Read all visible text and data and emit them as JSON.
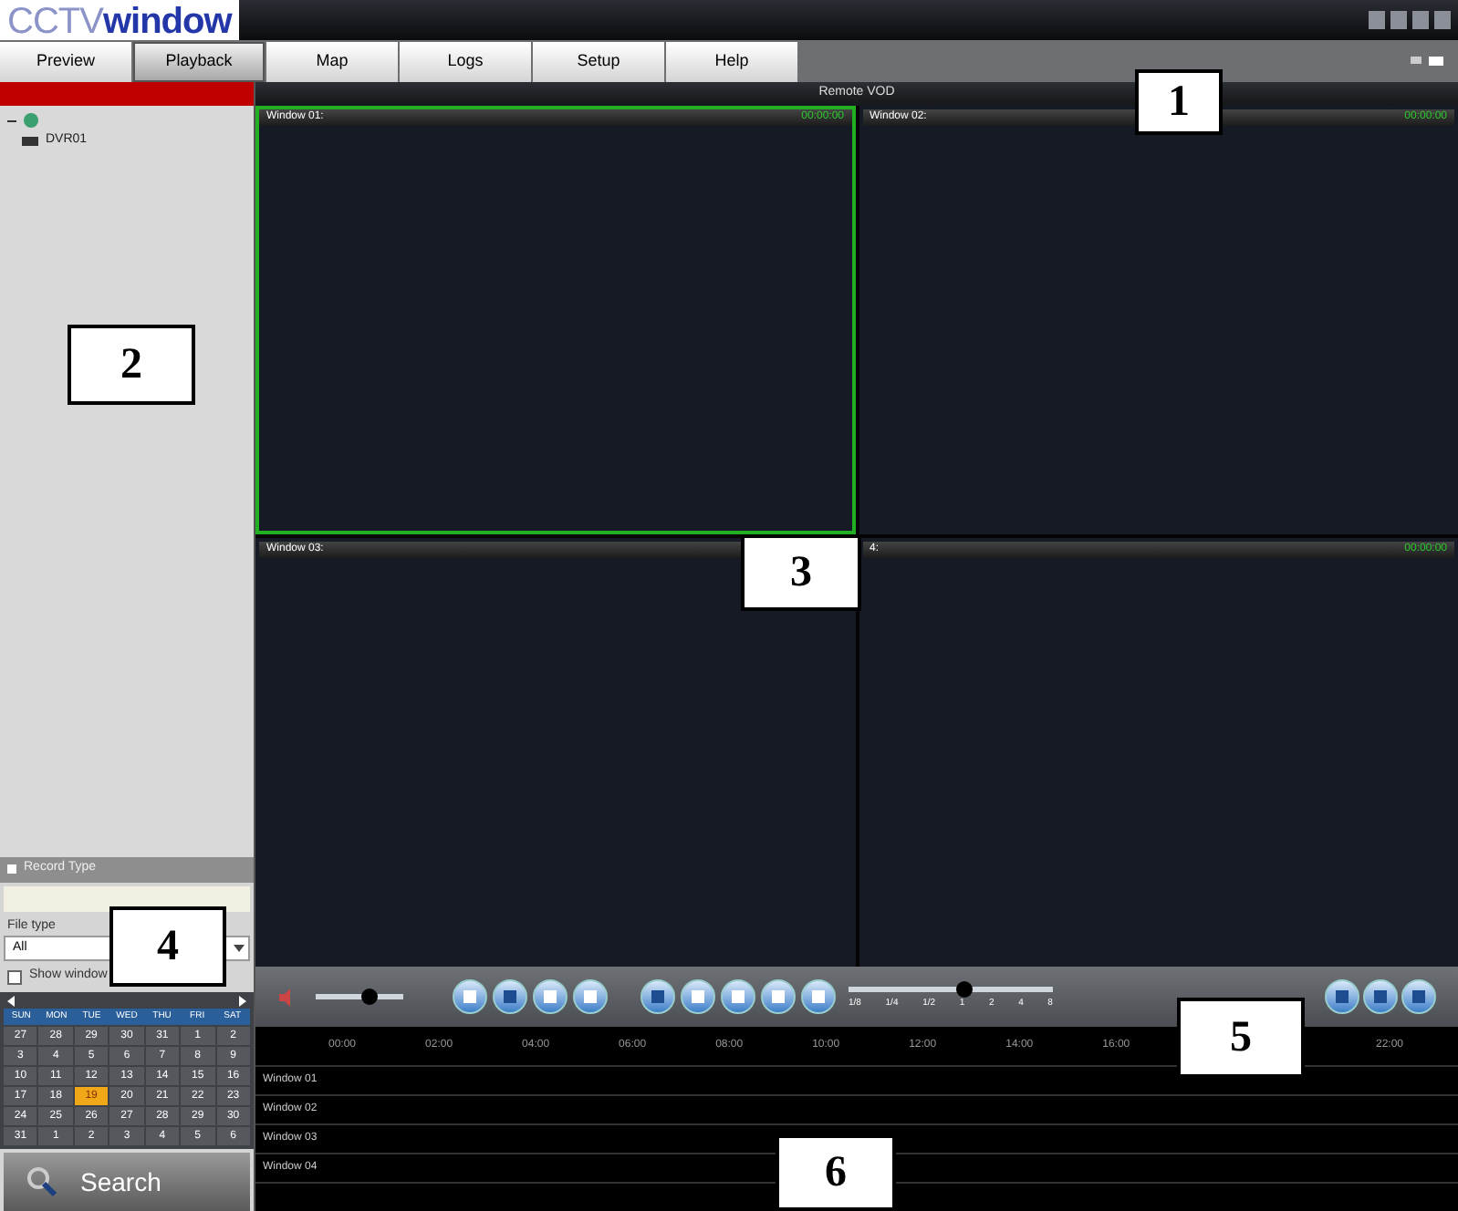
{
  "logo": {
    "part1": "CCTV",
    "part2": "window"
  },
  "tabs": [
    {
      "label": "Preview",
      "selected": false
    },
    {
      "label": "Playback",
      "selected": true
    },
    {
      "label": "Map",
      "selected": false
    },
    {
      "label": "Logs",
      "selected": false
    },
    {
      "label": "Setup",
      "selected": false
    },
    {
      "label": "Help",
      "selected": false
    }
  ],
  "sidebar": {
    "tree": [
      {
        "expanded": true,
        "children": [
          {
            "label": "DVR01"
          }
        ]
      }
    ],
    "section_title": "Record Type",
    "field_label": "File type",
    "select_value": "All",
    "checkbox": {
      "label": "Show window",
      "checked": false
    },
    "calendar": {
      "weekdays": [
        "SUN",
        "MON",
        "TUE",
        "WED",
        "THU",
        "FRI",
        "SAT"
      ],
      "days": [
        {
          "label": "27",
          "selected": false
        },
        {
          "label": "28",
          "selected": false
        },
        {
          "label": "29",
          "selected": false
        },
        {
          "label": "30",
          "selected": false
        },
        {
          "label": "31",
          "selected": false
        },
        {
          "label": "1",
          "selected": false
        },
        {
          "label": "2",
          "selected": false
        },
        {
          "label": "3",
          "selected": false
        },
        {
          "label": "4",
          "selected": false
        },
        {
          "label": "5",
          "selected": false
        },
        {
          "label": "6",
          "selected": false
        },
        {
          "label": "7",
          "selected": false
        },
        {
          "label": "8",
          "selected": false
        },
        {
          "label": "9",
          "selected": false
        },
        {
          "label": "10",
          "selected": false
        },
        {
          "label": "11",
          "selected": false
        },
        {
          "label": "12",
          "selected": false
        },
        {
          "label": "13",
          "selected": false
        },
        {
          "label": "14",
          "selected": false
        },
        {
          "label": "15",
          "selected": false
        },
        {
          "label": "16",
          "selected": false
        },
        {
          "label": "17",
          "selected": false
        },
        {
          "label": "18",
          "selected": false
        },
        {
          "label": "19",
          "selected": true
        },
        {
          "label": "20",
          "selected": false
        },
        {
          "label": "21",
          "selected": false
        },
        {
          "label": "22",
          "selected": false
        },
        {
          "label": "23",
          "selected": false
        },
        {
          "label": "24",
          "selected": false
        },
        {
          "label": "25",
          "selected": false
        },
        {
          "label": "26",
          "selected": false
        },
        {
          "label": "27",
          "selected": false
        },
        {
          "label": "28",
          "selected": false
        },
        {
          "label": "29",
          "selected": false
        },
        {
          "label": "30",
          "selected": false
        },
        {
          "label": "31",
          "selected": false
        },
        {
          "label": "1",
          "selected": false
        },
        {
          "label": "2",
          "selected": false
        },
        {
          "label": "3",
          "selected": false
        },
        {
          "label": "4",
          "selected": false
        },
        {
          "label": "5",
          "selected": false
        },
        {
          "label": "6",
          "selected": false
        }
      ]
    },
    "search_button": "Search"
  },
  "view_title": "Remote VOD",
  "video_windows": [
    {
      "title": "Window 01:",
      "time": "00:00:00",
      "selected": true
    },
    {
      "title": "Window 02:",
      "time": "00:00:00",
      "selected": false
    },
    {
      "title": "Window 03:",
      "selected": false
    },
    {
      "title": "4:",
      "time": "00:00:00",
      "selected": false
    }
  ],
  "controls": {
    "volume": {
      "level": 0.6
    },
    "speed": {
      "level": 0.56,
      "labels": [
        "1/8",
        "1/4",
        "1/2",
        "1",
        "2",
        "4",
        "8"
      ]
    }
  },
  "timeline": {
    "hours": [
      "00:00",
      "02:00",
      "04:00",
      "06:00",
      "08:00",
      "10:00",
      "12:00",
      "14:00",
      "16:00",
      "22:00"
    ],
    "rows": [
      "Window 01",
      "Window 02",
      "Window 03",
      "Window 04"
    ]
  },
  "callouts": [
    "1",
    "2",
    "3",
    "4",
    "5",
    "6"
  ]
}
